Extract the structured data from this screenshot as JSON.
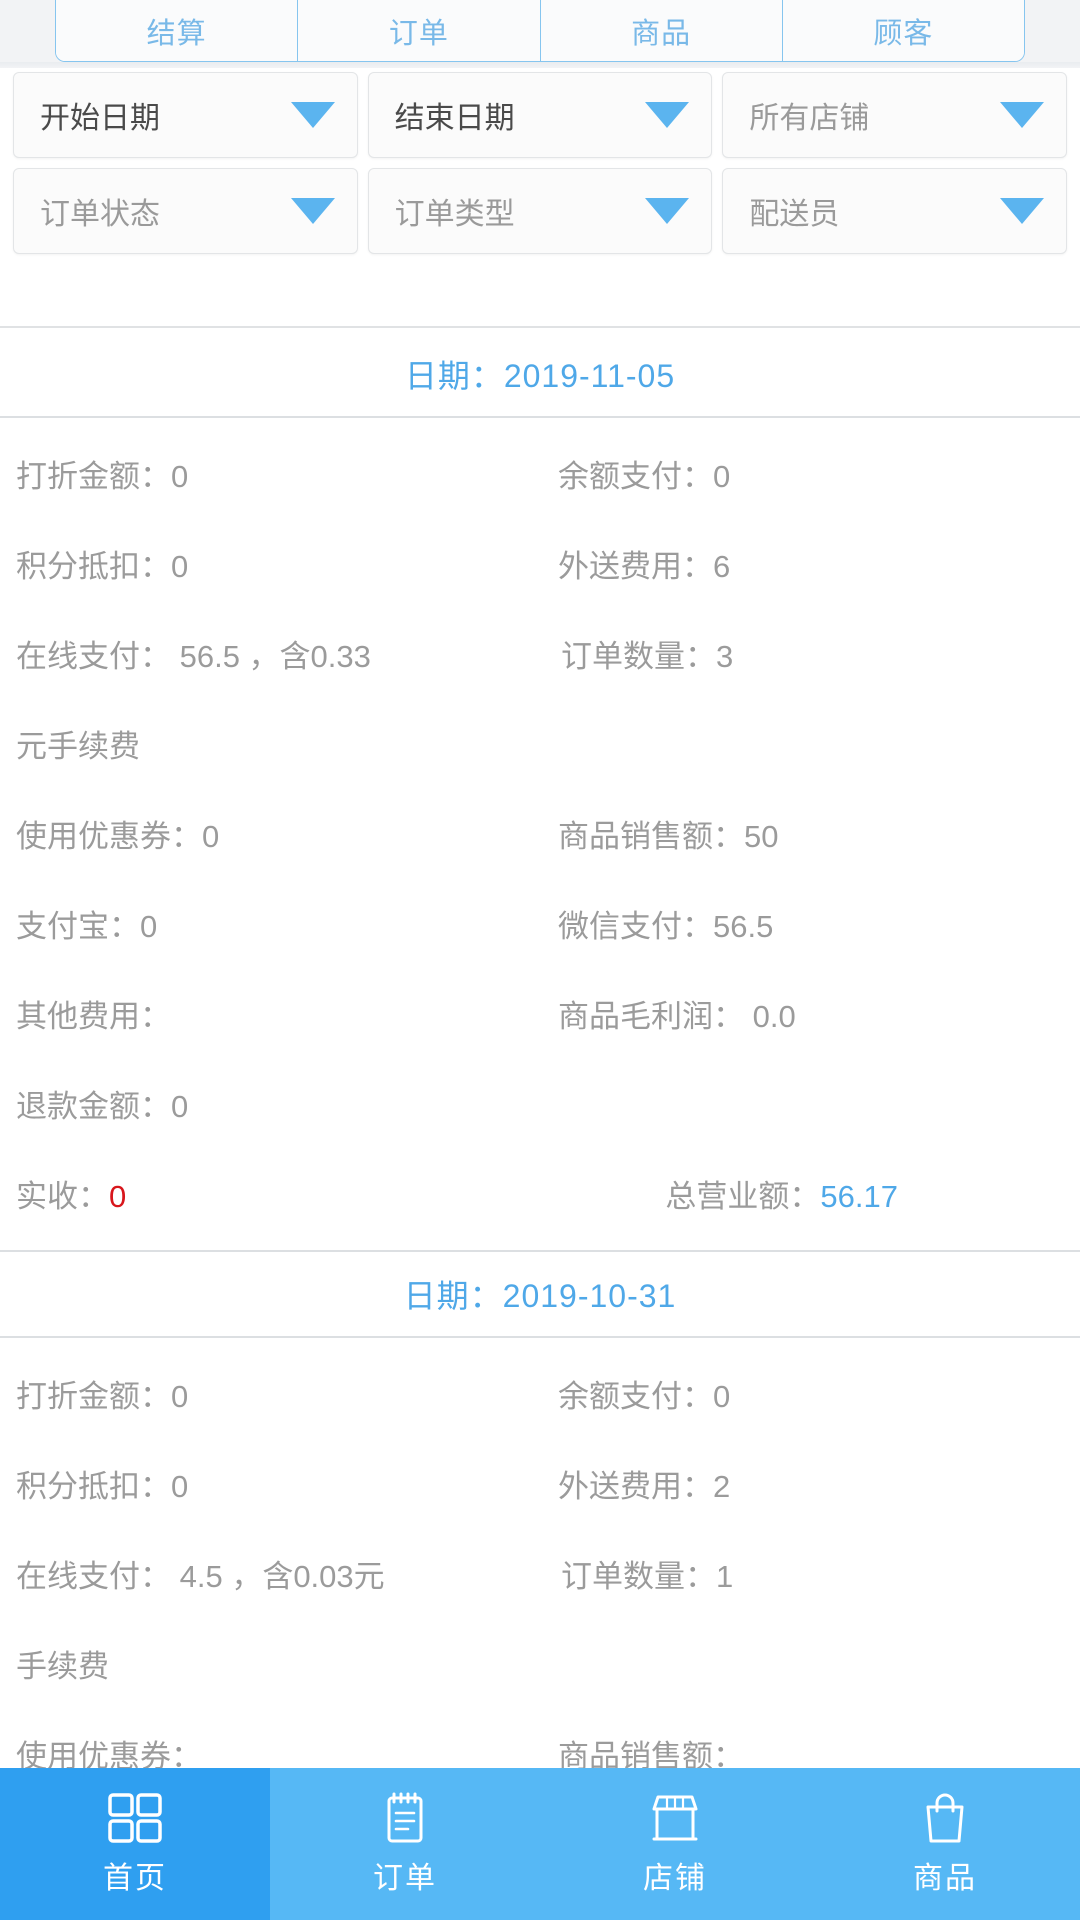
{
  "tabs": [
    {
      "label": "结算"
    },
    {
      "label": "订单"
    },
    {
      "label": "商品"
    },
    {
      "label": "顾客"
    }
  ],
  "filters": {
    "row1": [
      {
        "label": "开始日期",
        "style": "dark",
        "icon": "chevron-down-icon"
      },
      {
        "label": "结束日期",
        "style": "dark",
        "icon": "chevron-down-icon"
      },
      {
        "label": "所有店铺",
        "style": "muted",
        "icon": "chevron-down-icon"
      }
    ],
    "row2": [
      {
        "label": "订单状态",
        "style": "muted",
        "icon": "chevron-down-icon"
      },
      {
        "label": "订单类型",
        "style": "muted",
        "icon": "chevron-down-icon"
      },
      {
        "label": "配送员",
        "style": "muted",
        "icon": "chevron-down-icon"
      }
    ]
  },
  "records": [
    {
      "date_header": "日期：2019-11-05",
      "discount_label": "打折金额：0",
      "balance_label": "余额支付：0",
      "points_label": "积分抵扣：0",
      "delivery_fee_label": "外送费用：6",
      "online_pay_label": "在线支付： 56.5 ，含0.33",
      "online_pay_wrap": "元手续费",
      "order_count_label": "订单数量：3",
      "coupon_label": "使用优惠券：0",
      "goods_sales_label": "商品销售额：50",
      "alipay_label": "支付宝：0",
      "wechat_label": "微信支付：56.5",
      "other_fee_label": "其他费用：",
      "gross_profit_label": "商品毛利润： 0.0",
      "refund_label": "退款金额：0",
      "received_prefix": "实收：",
      "received_value": "0",
      "turnover_prefix": "总营业额：",
      "turnover_value": "56.17"
    },
    {
      "date_header": "日期：2019-10-31",
      "discount_label": "打折金额：0",
      "balance_label": "余额支付：0",
      "points_label": "积分抵扣：0",
      "delivery_fee_label": "外送费用：2",
      "online_pay_label": "在线支付： 4.5 ，含0.03元",
      "online_pay_wrap": "手续费",
      "order_count_label": "订单数量：1",
      "coupon_label": "使用优惠券：",
      "goods_sales_label": "商品销售额："
    }
  ],
  "bottom_nav": [
    {
      "label": "首页",
      "icon": "grid-home-icon",
      "active": true
    },
    {
      "label": "订单",
      "icon": "clipboard-order-icon",
      "active": false
    },
    {
      "label": "店铺",
      "icon": "storefront-shop-icon",
      "active": false
    },
    {
      "label": "商品",
      "icon": "shopping-bag-icon",
      "active": false
    }
  ],
  "colors": {
    "accent": "#4fa8e8",
    "nav_bg": "#56b8f5",
    "nav_active_bg": "#2f9ff0",
    "caret": "#5bb4ef",
    "text_muted": "#9b9b9b",
    "value_red": "#d8161c"
  }
}
